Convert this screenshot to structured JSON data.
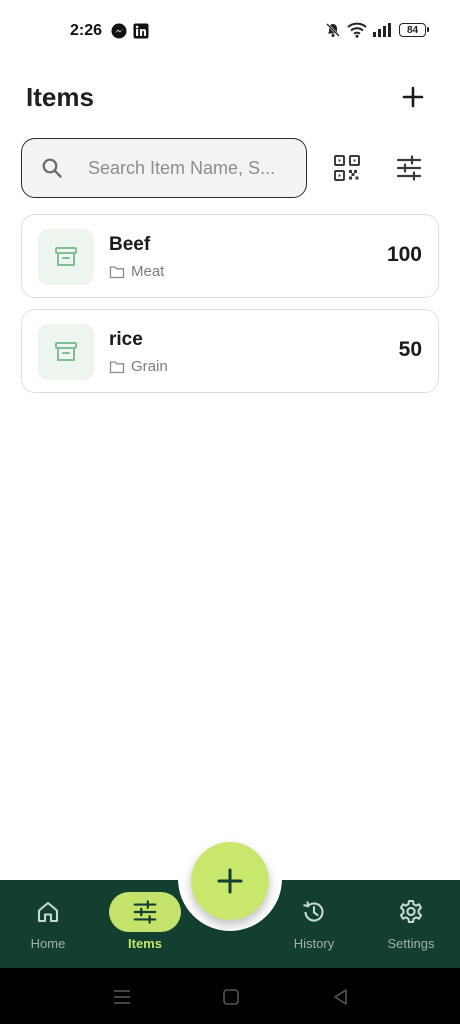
{
  "status_bar": {
    "time": "2:26",
    "battery": "84",
    "icons": [
      "messenger-icon",
      "linkedin-icon",
      "mute-icon",
      "wifi-icon",
      "signal-icon",
      "battery-icon"
    ]
  },
  "header": {
    "title": "Items",
    "add_icon": "plus-icon"
  },
  "search": {
    "placeholder": "Search Item Name, S...",
    "value": ""
  },
  "toolbar": {
    "qr_icon": "qr-scan-icon",
    "filter_icon": "tune-icon"
  },
  "items": [
    {
      "name": "Beef",
      "category": "Meat",
      "quantity": "100"
    },
    {
      "name": "rice",
      "category": "Grain",
      "quantity": "50"
    }
  ],
  "bottom_nav": {
    "items": [
      {
        "label": "Home",
        "icon": "home-icon",
        "active": false
      },
      {
        "label": "Items",
        "icon": "tune-icon",
        "active": true
      },
      {
        "label": "History",
        "icon": "history-icon",
        "active": false
      },
      {
        "label": "Settings",
        "icon": "gear-icon",
        "active": false
      }
    ],
    "fab_icon": "plus-icon"
  },
  "colors": {
    "nav_background": "#123f2f",
    "accent": "#c5e36a",
    "thumb_background": "#eef5ee",
    "thumb_icon": "#7fbf96"
  }
}
